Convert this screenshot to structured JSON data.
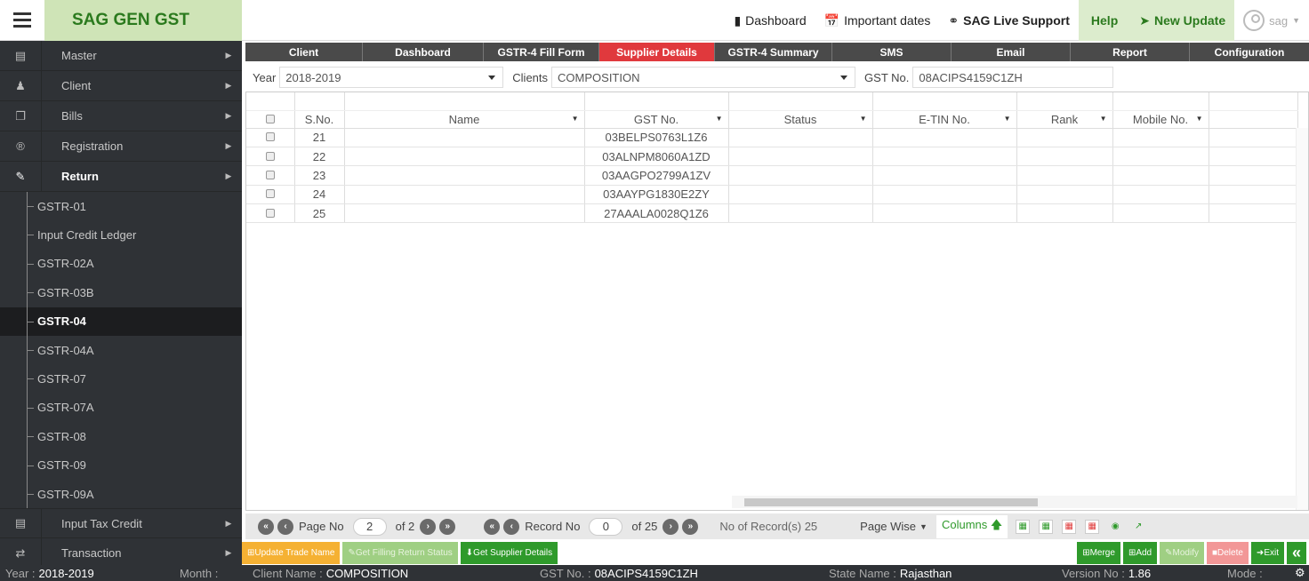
{
  "header": {
    "brand": "SAG GEN GST",
    "nav": [
      {
        "label": "Dashboard",
        "icon": "document-icon"
      },
      {
        "label": "Important dates",
        "icon": "calendar-icon"
      },
      {
        "label": "SAG Live Support",
        "icon": "chat-icon"
      },
      {
        "label": "Help"
      },
      {
        "label": "New Update",
        "icon": "tag-icon"
      }
    ],
    "user": "sag"
  },
  "sidebar": {
    "items": [
      {
        "label": "Master",
        "icon": "list-icon"
      },
      {
        "label": "Client",
        "icon": "users-icon"
      },
      {
        "label": "Bills",
        "icon": "copy-icon"
      },
      {
        "label": "Registration",
        "icon": "registered-icon"
      },
      {
        "label": "Return",
        "icon": "edit-icon"
      }
    ],
    "subitems": [
      "GSTR-01",
      "Input Credit Ledger",
      "GSTR-02A",
      "GSTR-03B",
      "GSTR-04",
      "GSTR-04A",
      "GSTR-07",
      "GSTR-07A",
      "GSTR-08",
      "GSTR-09",
      "GSTR-09A"
    ],
    "selected_subitem": "GSTR-04",
    "bottom_items": [
      {
        "label": "Input Tax Credit",
        "icon": "card-icon"
      },
      {
        "label": "Transaction",
        "icon": "exchange-icon"
      }
    ]
  },
  "tabs": [
    "Client",
    "Dashboard",
    "GSTR-4 Fill Form",
    "Supplier Details",
    "GSTR-4 Summary",
    "SMS",
    "Email",
    "Report",
    "Configuration"
  ],
  "active_tab": "Supplier Details",
  "filters": {
    "year_label": "Year",
    "year_value": "2018-2019",
    "clients_label": "Clients",
    "clients_value": "COMPOSITION",
    "gst_label": "GST No.",
    "gst_value": "08ACIPS4159C1ZH"
  },
  "grid": {
    "columns": [
      "S.No.",
      "Name",
      "GST No.",
      "Status",
      "E-TIN No.",
      "Rank",
      "Mobile No."
    ],
    "rows": [
      {
        "sno": "21",
        "name": "",
        "gst": "03BELPS0763L1Z6",
        "status": "",
        "etin": "",
        "rank": "",
        "mobile": ""
      },
      {
        "sno": "22",
        "name": "",
        "gst": "03ALNPM8060A1ZD",
        "status": "",
        "etin": "",
        "rank": "",
        "mobile": ""
      },
      {
        "sno": "23",
        "name": "",
        "gst": "03AAGPO2799A1ZV",
        "status": "",
        "etin": "",
        "rank": "",
        "mobile": ""
      },
      {
        "sno": "24",
        "name": "",
        "gst": "03AAYPG1830E2ZY",
        "status": "",
        "etin": "",
        "rank": "",
        "mobile": ""
      },
      {
        "sno": "25",
        "name": "",
        "gst": "27AAALA0028Q1Z6",
        "status": "",
        "etin": "",
        "rank": "",
        "mobile": ""
      }
    ]
  },
  "pager": {
    "page_label": "Page No",
    "page_value": "2",
    "page_of": "of 2",
    "record_label": "Record No",
    "record_value": "0",
    "record_of": "of 25",
    "count_text": "No of Record(s) 25",
    "mode": "Page Wise",
    "columns_label": "Columns"
  },
  "actions": {
    "update_trade_name": "Update Trade Name",
    "get_filing_status": "Get Filling Return Status",
    "get_supplier_details": "Get Supplier Details",
    "merge": "Merge",
    "add": "Add",
    "modify": "Modify",
    "delete": "Delete",
    "exit": "Exit"
  },
  "status": {
    "year_label": "Year :",
    "year_value": "2018-2019",
    "month_label": "Month :",
    "client_label": "Client Name :",
    "client_value": "COMPOSITION",
    "gst_label": "GST No. :",
    "gst_value": "08ACIPS4159C1ZH",
    "state_label": "State Name :",
    "state_value": "Rajasthan",
    "version_label": "Version No :",
    "version_value": "1.86",
    "mode_label": "Mode :"
  }
}
